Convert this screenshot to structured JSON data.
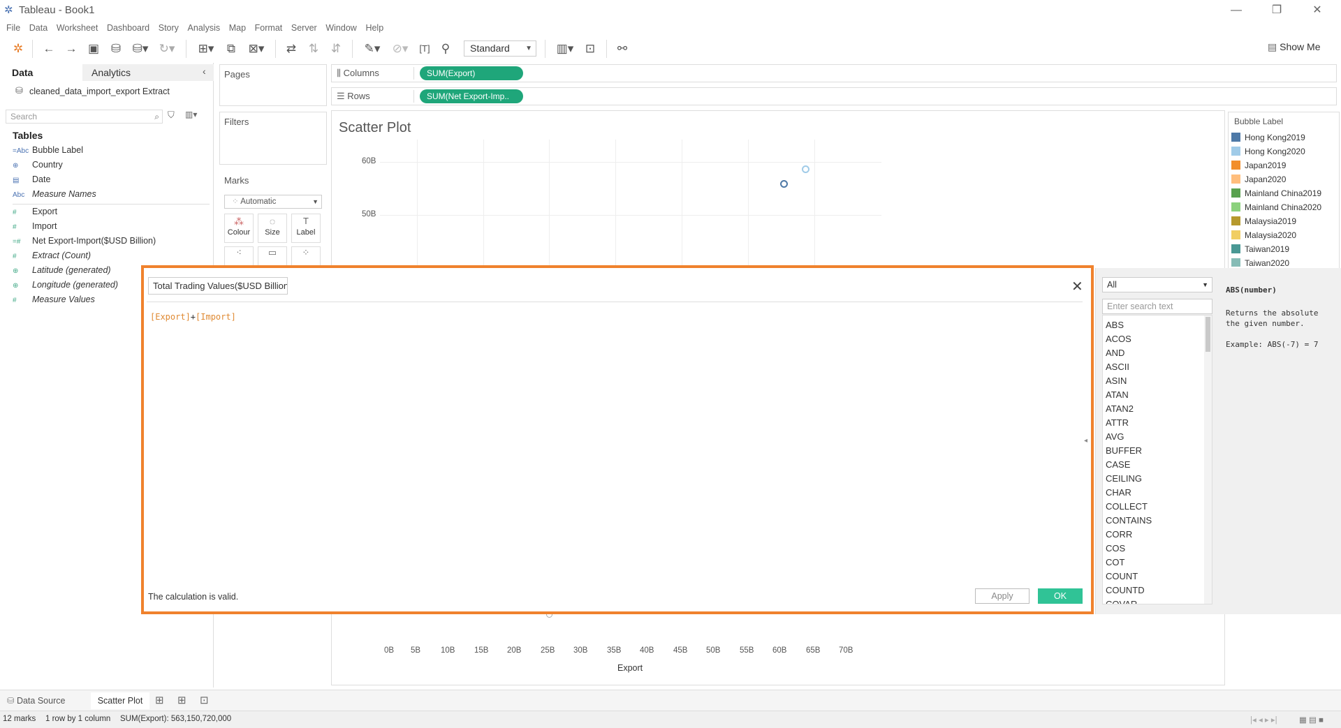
{
  "app": {
    "title": "Tableau - Book1",
    "window_controls": {
      "minimize": "—",
      "maximize": "❐",
      "close": "✕"
    }
  },
  "menu": [
    "File",
    "Data",
    "Worksheet",
    "Dashboard",
    "Story",
    "Analysis",
    "Map",
    "Format",
    "Server",
    "Window",
    "Help"
  ],
  "toolbar": {
    "fit_select": "Standard",
    "show_me_label": "Show Me"
  },
  "data_pane": {
    "tab_data": "Data",
    "tab_analytics": "Analytics",
    "datasource": "cleaned_data_import_export Extract",
    "search_placeholder": "Search",
    "tables_heading": "Tables",
    "fields": [
      {
        "icon": "=Abc",
        "label": "Bubble Label",
        "type": "dim"
      },
      {
        "icon": "⊕",
        "label": "Country",
        "type": "dim"
      },
      {
        "icon": "▤",
        "label": "Date",
        "type": "dim"
      },
      {
        "icon": "Abc",
        "label": "Measure Names",
        "type": "dim"
      },
      {
        "icon": "#",
        "label": "Export",
        "type": "measure"
      },
      {
        "icon": "#",
        "label": "Import",
        "type": "measure"
      },
      {
        "icon": "=#",
        "label": "Net Export-Import($USD Billion)",
        "type": "measure"
      },
      {
        "icon": "#",
        "label": "Extract (Count)",
        "type": "measure"
      },
      {
        "icon": "⊕",
        "label": "Latitude (generated)",
        "type": "measure"
      },
      {
        "icon": "⊕",
        "label": "Longitude (generated)",
        "type": "measure"
      },
      {
        "icon": "#",
        "label": "Measure Values",
        "type": "measure"
      }
    ]
  },
  "shelves": {
    "pages": "Pages",
    "filters": "Filters",
    "marks": "Marks",
    "mark_type": "Automatic",
    "mark_buttons": [
      "Colour",
      "Size",
      "Label"
    ],
    "columns_label": "Columns",
    "rows_label": "Rows",
    "columns_pill": "SUM(Export)",
    "rows_pill": "SUM(Net Export-Imp.."
  },
  "viz": {
    "title": "Scatter Plot",
    "y_ticks": [
      "60B",
      "50B"
    ],
    "x_ticks": [
      "0B",
      "5B",
      "10B",
      "15B",
      "20B",
      "25B",
      "30B",
      "35B",
      "40B",
      "45B",
      "50B",
      "55B",
      "60B",
      "65B",
      "70B"
    ],
    "x_label": "Export"
  },
  "legend": {
    "title": "Bubble Label",
    "items": [
      {
        "label": "Hong Kong2019",
        "color": "#4e79a7"
      },
      {
        "label": "Hong Kong2020",
        "color": "#a0cbe8"
      },
      {
        "label": "Japan2019",
        "color": "#f28e2b"
      },
      {
        "label": "Japan2020",
        "color": "#ffbe7d"
      },
      {
        "label": "Mainland China2019",
        "color": "#59a14f"
      },
      {
        "label": "Mainland China2020",
        "color": "#8cd17d"
      },
      {
        "label": "Malaysia2019",
        "color": "#b6992d"
      },
      {
        "label": "Malaysia2020",
        "color": "#f1ce63"
      },
      {
        "label": "Taiwan2019",
        "color": "#499894"
      },
      {
        "label": "Taiwan2020",
        "color": "#86bcb6"
      }
    ]
  },
  "calc_dialog": {
    "name": "Total Trading Values($USD Billion)",
    "formula_part1": "[Export]",
    "formula_op": "+",
    "formula_part2": "[Import]",
    "status": "The calculation is valid.",
    "apply_label": "Apply",
    "ok_label": "OK",
    "function_filter": "All",
    "function_search_placeholder": "Enter search text",
    "functions": [
      "ABS",
      "ACOS",
      "AND",
      "ASCII",
      "ASIN",
      "ATAN",
      "ATAN2",
      "ATTR",
      "AVG",
      "BUFFER",
      "CASE",
      "CEILING",
      "CHAR",
      "COLLECT",
      "CONTAINS",
      "CORR",
      "COS",
      "COT",
      "COUNT",
      "COUNTD",
      "COVAR"
    ],
    "help_signature": "ABS(number)",
    "help_text": "Returns the absolute\nthe given number.\n\nExample: ABS(-7) = 7"
  },
  "bottom": {
    "data_source_tab": "Data Source",
    "sheet_tab": "Scatter Plot",
    "marks_count": "12 marks",
    "rows_cols": "1 row by 1 column",
    "sum_export": "SUM(Export): 563,150,720,000"
  }
}
